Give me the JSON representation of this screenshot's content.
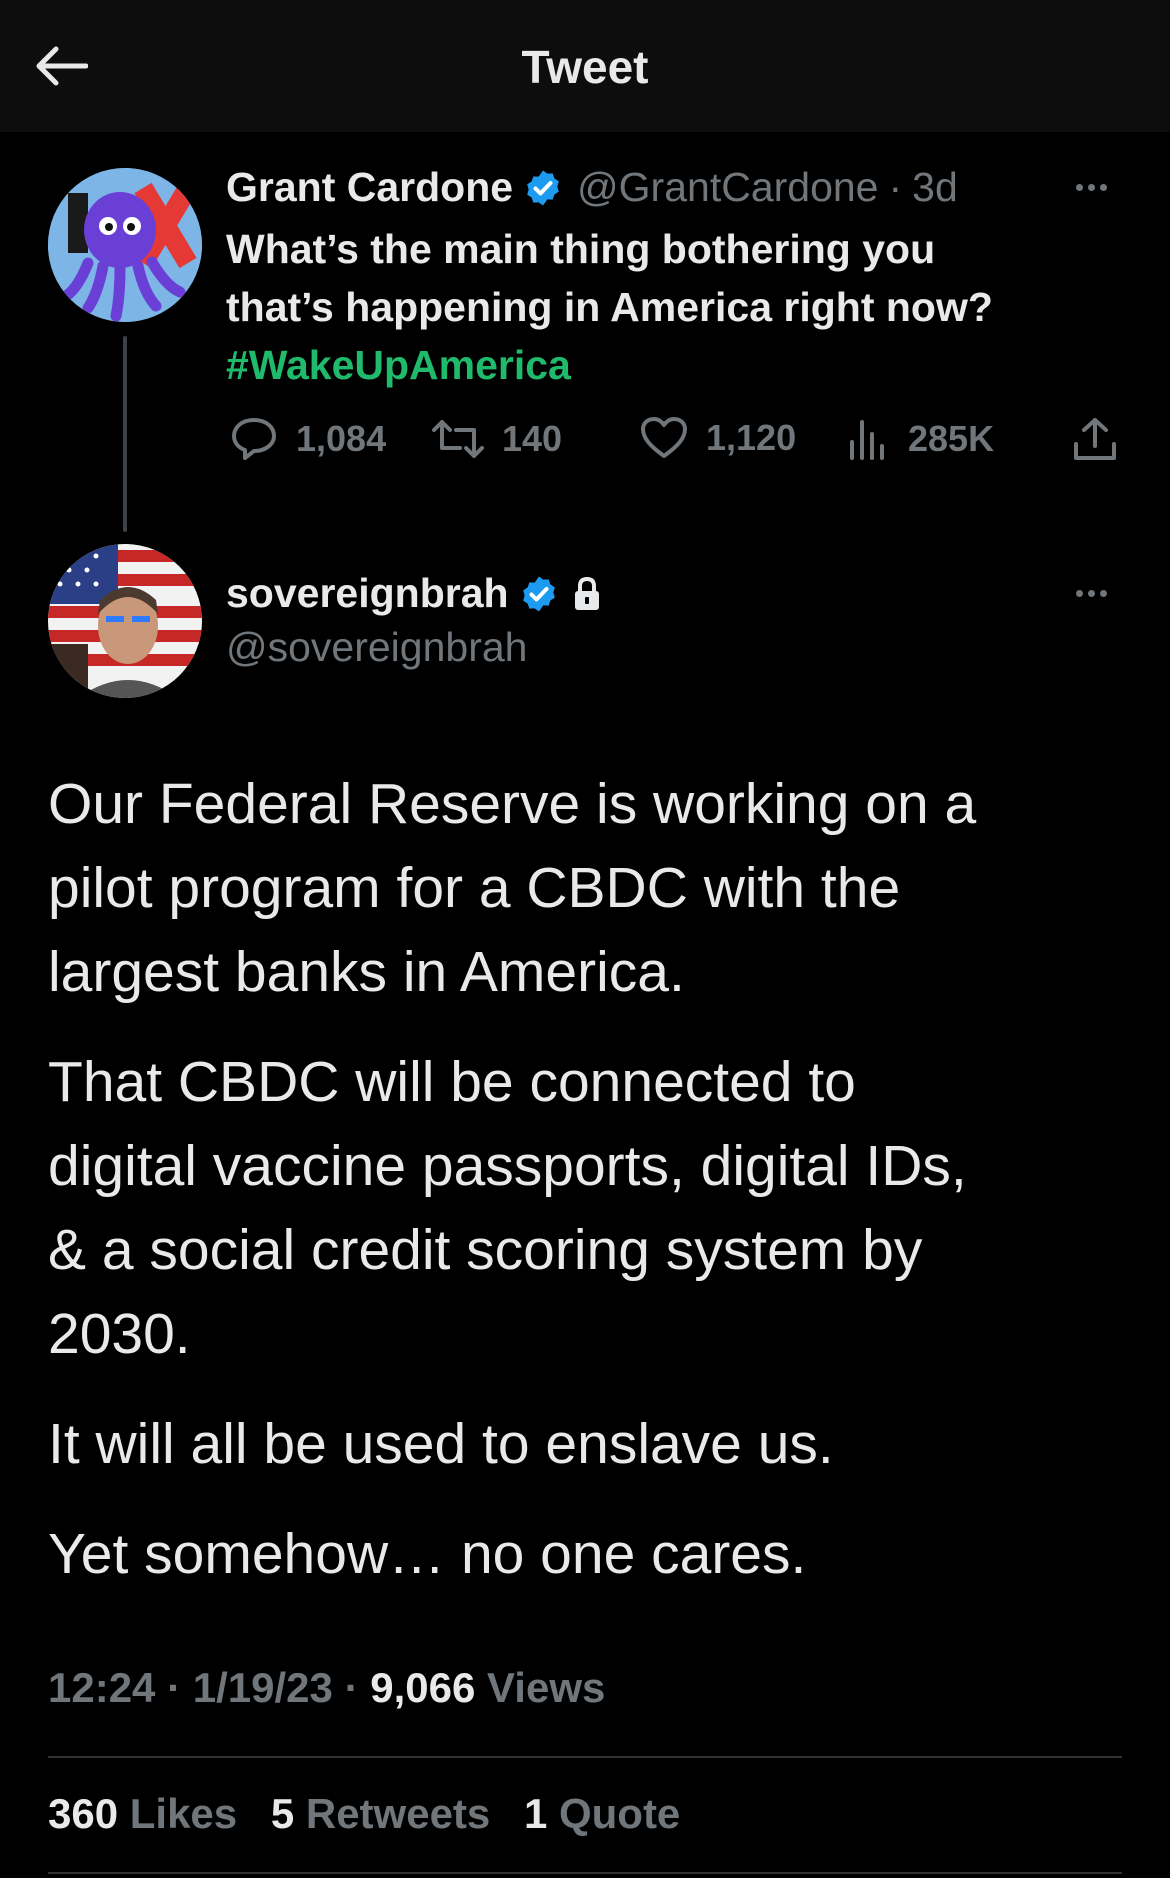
{
  "header": {
    "title": "Tweet",
    "back_icon": "arrow-left-icon"
  },
  "colors": {
    "background": "#000000",
    "accent_green": "#1fba6b",
    "verified_blue": "#1d9bf0",
    "muted": "#71767b"
  },
  "quoted_tweet": {
    "author_name": "Grant Cardone",
    "handle": "@GrantCardone",
    "separator": "·",
    "time": "3d",
    "text_lines": [
      "What’s the main thing bothering you",
      "that’s happening in America right now?"
    ],
    "hashtag": "#WakeUpAmerica",
    "replies": "1,084",
    "retweets": "140",
    "likes": "1,120",
    "views": "285K"
  },
  "reply_tweet": {
    "author_name": "sovereignbrah",
    "handle": "@sovereignbrah",
    "paragraphs": [
      [
        "Our Federal Reserve is working on a",
        "pilot program for a CBDC with the",
        "largest banks in America."
      ],
      [
        "That CBDC will be connected to",
        "digital vaccine passports, digital IDs,",
        "& a social credit scoring system by",
        "2030."
      ],
      [
        "It will all be used to enslave us."
      ],
      [
        "Yet somehow… no one cares."
      ]
    ],
    "time": "12:24",
    "sep": "·",
    "date": "1/19/23",
    "views_count": "9,066",
    "views_label": "Views",
    "likes_count": "360",
    "likes_label": "Likes",
    "retweets_count": "5",
    "retweets_label": "Retweets",
    "quotes_count": "1",
    "quotes_label": "Quote"
  }
}
